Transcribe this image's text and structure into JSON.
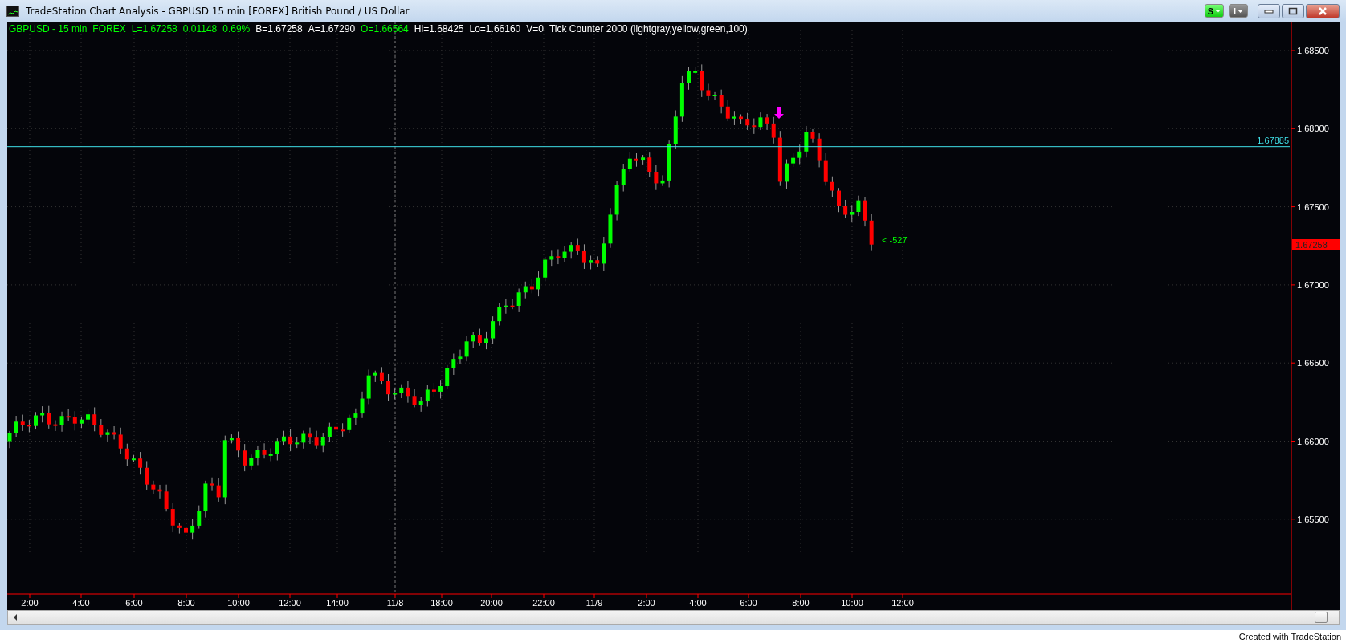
{
  "window": {
    "title": "TradeStation Chart Analysis - GBPUSD 15 min [FOREX] British Pound / US Dollar",
    "buttons": [
      {
        "label": "S",
        "kind": "style"
      },
      {
        "label": "I",
        "kind": "info"
      }
    ]
  },
  "legend": [
    {
      "text": "GBPUSD - 15 min",
      "color": "#00ff00"
    },
    {
      "text": "FOREX",
      "color": "#00ff00"
    },
    {
      "text": "L=1.67258",
      "color": "#00ff00"
    },
    {
      "text": "0.01148",
      "color": "#00ff00"
    },
    {
      "text": "0.69%",
      "color": "#00ff00"
    },
    {
      "text": "B=1.67258",
      "color": "#ffffff"
    },
    {
      "text": "A=1.67290",
      "color": "#ffffff"
    },
    {
      "text": "O=1.66564",
      "color": "#00ff00"
    },
    {
      "text": "Hi=1.68425",
      "color": "#ffffff"
    },
    {
      "text": "Lo=1.66160",
      "color": "#ffffff"
    },
    {
      "text": "V=0",
      "color": "#ffffff"
    },
    {
      "text": "Tick Counter 2000 (lightgray,yellow,green,100)",
      "color": "#ffffff"
    }
  ],
  "price_axis": {
    "labels": [
      "1.68500",
      "1.68000",
      "1.67500",
      "1.67000",
      "1.66500",
      "1.66000",
      "1.65500"
    ],
    "last_price": "1.67258"
  },
  "horizontal_line": {
    "label": "1.67885"
  },
  "tick_counter": "< -527",
  "time_axis": [
    "2:00",
    "4:00",
    "6:00",
    "8:00",
    "10:00",
    "12:00",
    "14:00",
    "11/8",
    "18:00",
    "20:00",
    "22:00",
    "11/9",
    "2:00",
    "4:00",
    "6:00",
    "8:00",
    "10:00",
    "12:00"
  ],
  "footer": "Created with TradeStation"
}
